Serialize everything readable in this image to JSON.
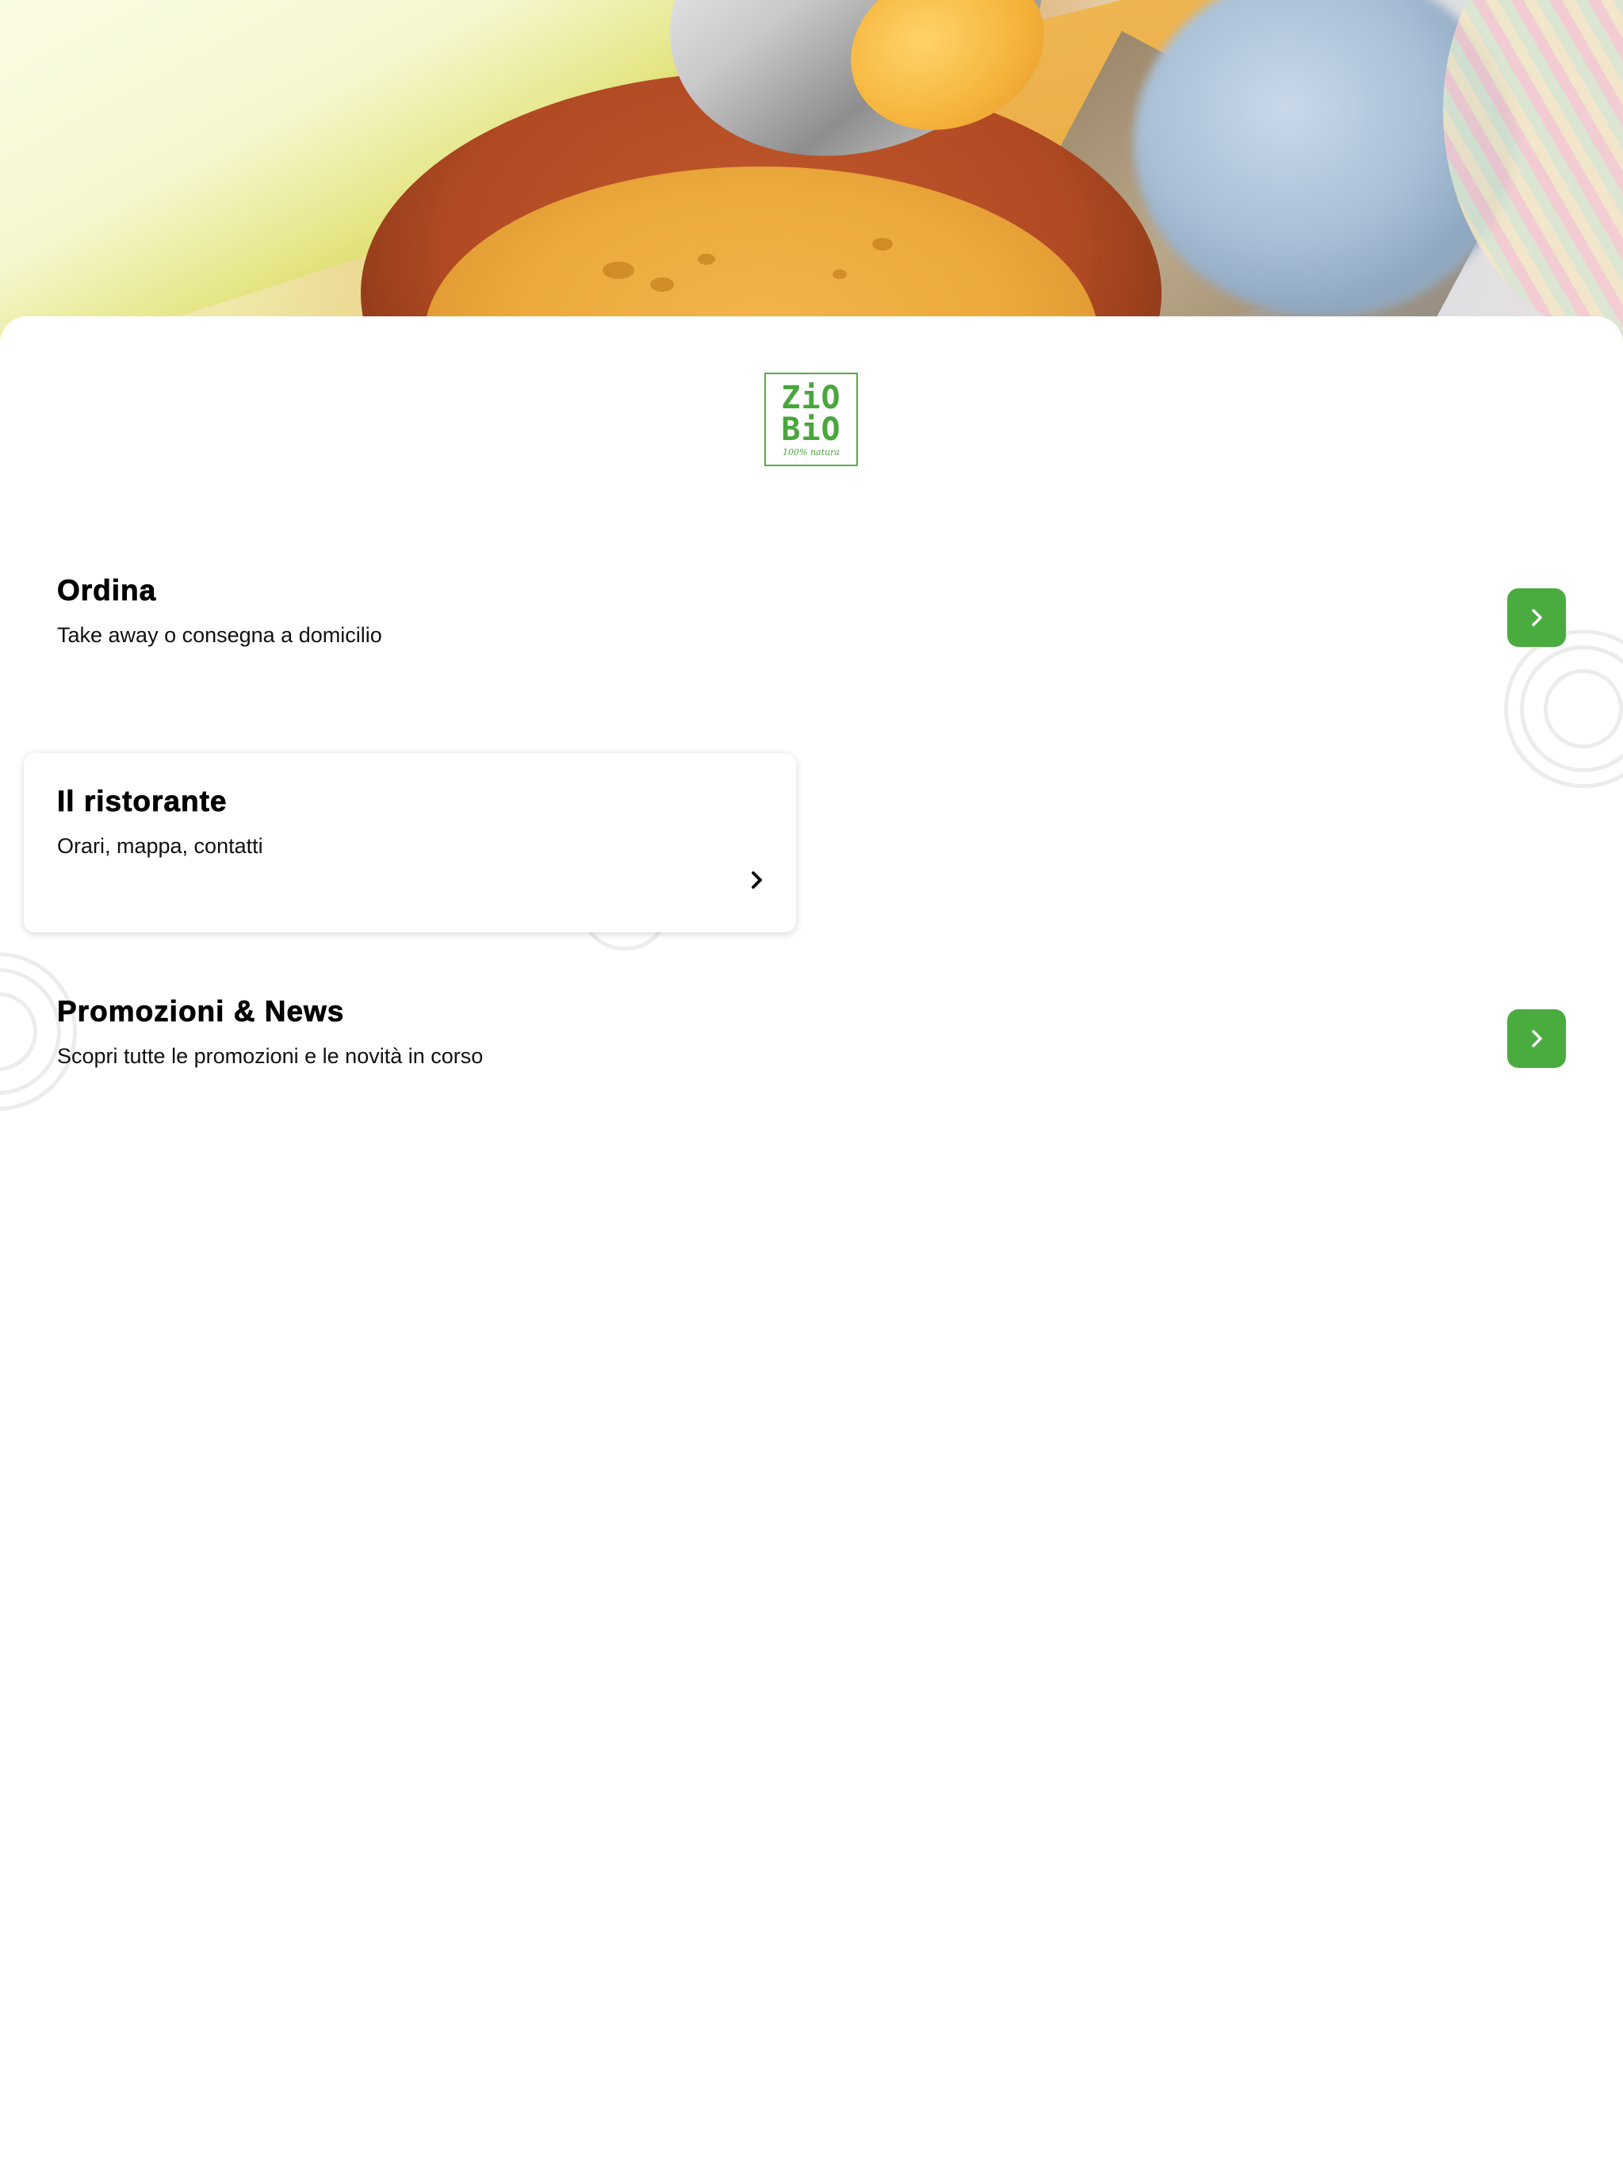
{
  "hero": {
    "image": "soup-bowl-with-spoon-photo"
  },
  "logo": {
    "line1": "ZiO",
    "line2": "BiO",
    "tagline": "100% natura",
    "color": "#4aa53d"
  },
  "menu": {
    "items": [
      {
        "title": "Ordina",
        "subtitle": "Take away o consegna a domicilio",
        "icon": "chevron-right-icon",
        "style": "green-button"
      },
      {
        "title": "Il ristorante",
        "subtitle": "Orari, mappa, contatti",
        "icon": "chevron-right-icon",
        "style": "card"
      },
      {
        "title": "Promozioni & News",
        "subtitle": "Scopri tutte le promozioni e le novità in corso",
        "icon": "chevron-right-icon",
        "style": "green-button"
      }
    ]
  },
  "colors": {
    "accent": "#4aac3f",
    "text": "#000000",
    "ring": "#ececec"
  }
}
